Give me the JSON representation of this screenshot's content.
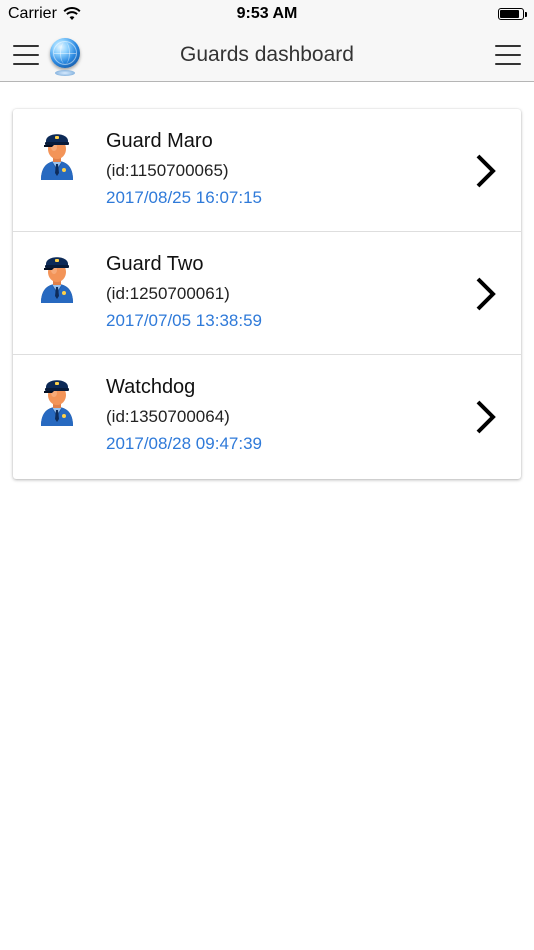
{
  "status_bar": {
    "carrier": "Carrier",
    "time": "9:53 AM",
    "battery_level": 0.85
  },
  "nav": {
    "title": "Guards dashboard",
    "left_menu_icon": "hamburger-menu-icon",
    "logo_icon": "globe-icon",
    "right_menu_icon": "hamburger-menu-icon"
  },
  "guards": [
    {
      "name": "Guard Maro",
      "id_text": "(id:1150700065)",
      "timestamp": "2017/08/25 16:07:15",
      "icon": "guard-avatar-icon"
    },
    {
      "name": "Guard Two",
      "id_text": "(id:1250700061)",
      "timestamp": "2017/07/05 13:38:59",
      "icon": "guard-avatar-icon"
    },
    {
      "name": "Watchdog",
      "id_text": "(id:1350700064)",
      "timestamp": "2017/08/28 09:47:39",
      "icon": "guard-avatar-icon"
    }
  ],
  "colors": {
    "timestamp": "#2f7ad9",
    "nav_background": "#f7f7f7"
  }
}
